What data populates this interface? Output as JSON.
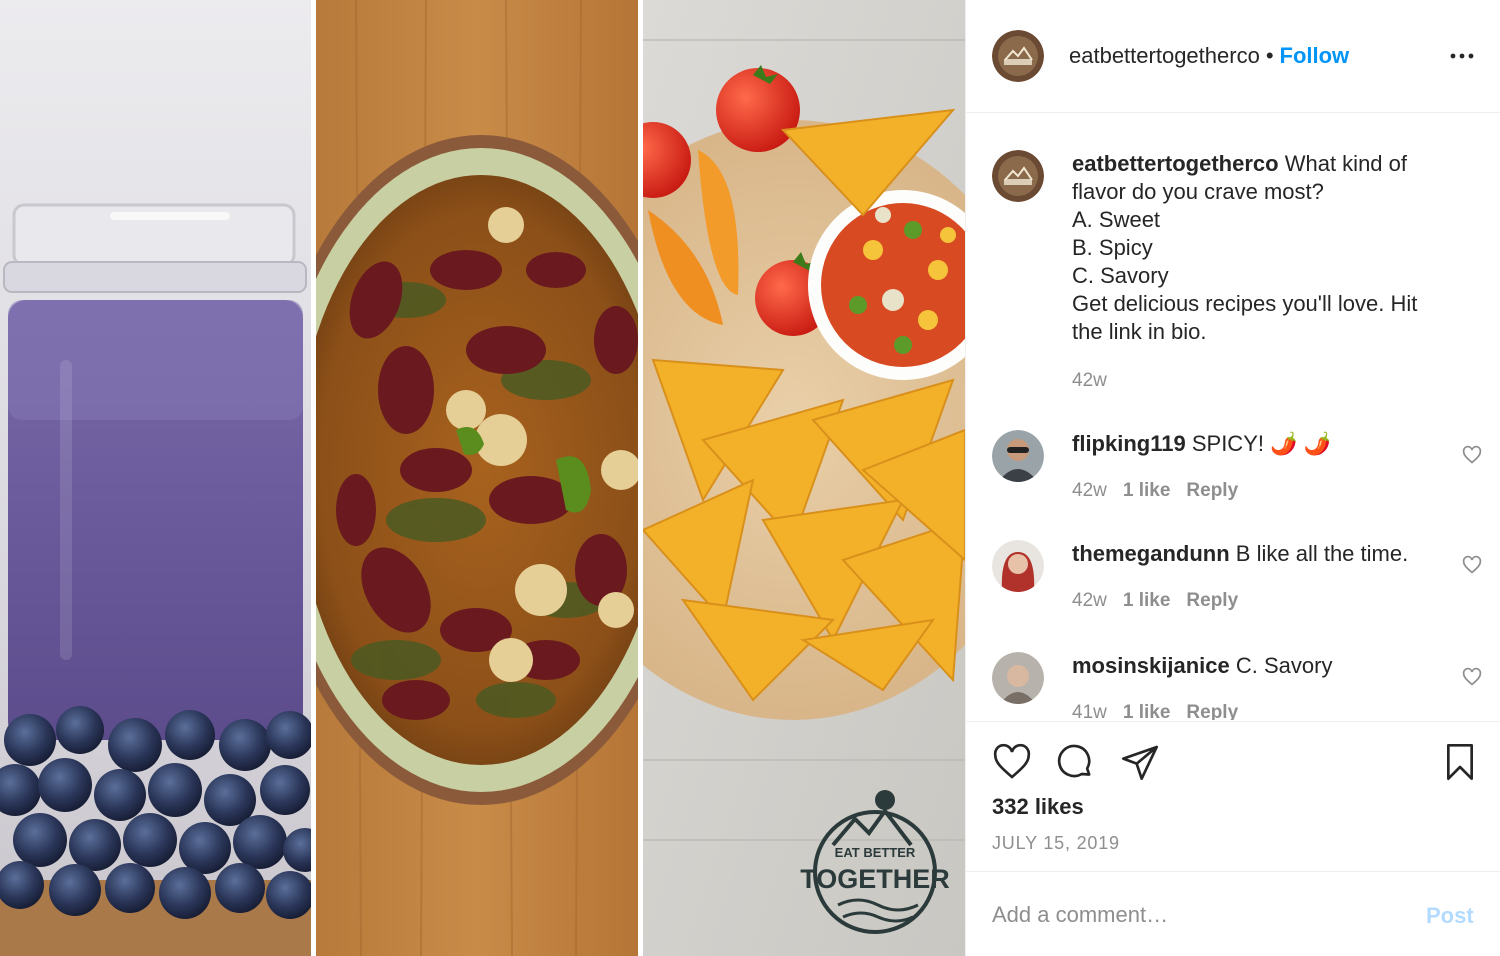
{
  "post": {
    "username": "eatbettertogetherco",
    "separator": "•",
    "follow_label": "Follow",
    "more_icon": "more-horizontal-icon"
  },
  "caption": {
    "username": "eatbettertogetherco",
    "lines": [
      "What kind of",
      "flavor do you crave most?",
      "A. Sweet",
      "B. Spicy",
      "C. Savory",
      "Get delicious recipes you'll love. Hit",
      "the link in bio."
    ],
    "time": "42w"
  },
  "comments": [
    {
      "username": "flipking119",
      "text": "SPICY! 🌶️ 🌶️",
      "time": "42w",
      "likes": "1 like",
      "reply": "Reply"
    },
    {
      "username": "themegandunn",
      "text": "B like all the time.",
      "time": "42w",
      "likes": "1 like",
      "reply": "Reply"
    },
    {
      "username": "mosinskijanice",
      "text": "C. Savory",
      "time": "41w",
      "likes": "1 like",
      "reply": "Reply"
    }
  ],
  "stats": {
    "likes": "332 likes",
    "date": "JULY 15, 2019"
  },
  "comment_box": {
    "placeholder": "Add a comment…",
    "post_label": "Post"
  },
  "logo": {
    "line1": "EAT BETTER",
    "line2": "TOGETHER"
  },
  "colors": {
    "accent": "#0095f6",
    "post_disabled": "#b3dbff",
    "muted": "#8e8e8e",
    "border": "#efefef"
  }
}
